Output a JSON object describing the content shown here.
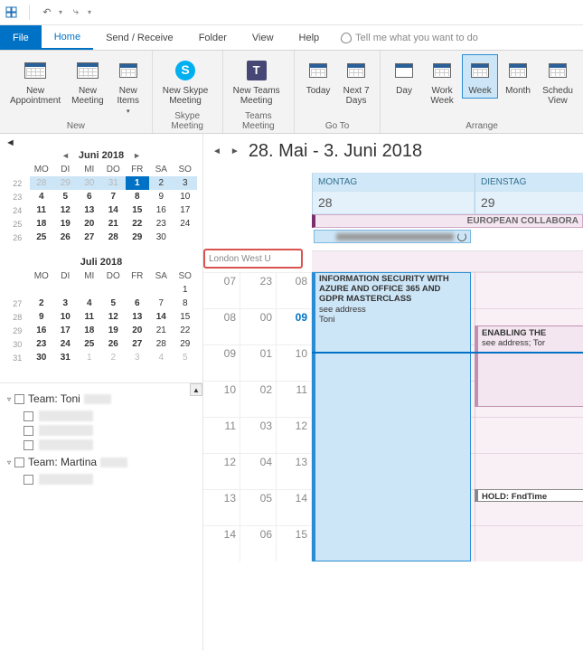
{
  "titlebar": {
    "icons": [
      "window-icon",
      "undo-icon",
      "redo-icon"
    ]
  },
  "menubar": {
    "file": "File",
    "tabs": [
      "Home",
      "Send / Receive",
      "Folder",
      "View",
      "Help"
    ],
    "active": 0,
    "tell_me": "Tell me what you want to do"
  },
  "ribbon": {
    "new": {
      "appointment": "New\nAppointment",
      "meeting": "New\nMeeting",
      "items": "New\nItems",
      "group_label": "New"
    },
    "skype": {
      "label": "New Skype\nMeeting",
      "group_label": "Skype Meeting"
    },
    "teams": {
      "label": "New Teams\nMeeting",
      "group_label": "Teams Meeting"
    },
    "goto": {
      "today": "Today",
      "next7": "Next 7\nDays",
      "group_label": "Go To"
    },
    "arrange": {
      "day": "Day",
      "workweek": "Work\nWeek",
      "week": "Week",
      "month": "Month",
      "schedule": "Schedu\nView",
      "group_label": "Arrange",
      "selected": "week"
    }
  },
  "minical1": {
    "title": "Juni 2018",
    "dow": [
      "MO",
      "DI",
      "MI",
      "DO",
      "FR",
      "SA",
      "SO"
    ],
    "weeks": [
      {
        "wk": "22",
        "days": [
          {
            "d": "28",
            "cls": "sel dim"
          },
          {
            "d": "29",
            "cls": "sel dim"
          },
          {
            "d": "30",
            "cls": "sel dim"
          },
          {
            "d": "31",
            "cls": "sel dim"
          },
          {
            "d": "1",
            "cls": "today"
          },
          {
            "d": "2",
            "cls": "sel"
          },
          {
            "d": "3",
            "cls": "sel"
          }
        ]
      },
      {
        "wk": "23",
        "days": [
          {
            "d": "4",
            "cls": "bold"
          },
          {
            "d": "5",
            "cls": "bold"
          },
          {
            "d": "6",
            "cls": "bold"
          },
          {
            "d": "7",
            "cls": "bold"
          },
          {
            "d": "8",
            "cls": "bold"
          },
          {
            "d": "9",
            "cls": ""
          },
          {
            "d": "10",
            "cls": ""
          }
        ]
      },
      {
        "wk": "24",
        "days": [
          {
            "d": "11",
            "cls": "bold"
          },
          {
            "d": "12",
            "cls": "bold"
          },
          {
            "d": "13",
            "cls": "bold"
          },
          {
            "d": "14",
            "cls": "bold"
          },
          {
            "d": "15",
            "cls": "bold"
          },
          {
            "d": "16",
            "cls": ""
          },
          {
            "d": "17",
            "cls": ""
          }
        ]
      },
      {
        "wk": "25",
        "days": [
          {
            "d": "18",
            "cls": "bold"
          },
          {
            "d": "19",
            "cls": "bold"
          },
          {
            "d": "20",
            "cls": "bold"
          },
          {
            "d": "21",
            "cls": "bold"
          },
          {
            "d": "22",
            "cls": "bold"
          },
          {
            "d": "23",
            "cls": ""
          },
          {
            "d": "24",
            "cls": ""
          }
        ]
      },
      {
        "wk": "26",
        "days": [
          {
            "d": "25",
            "cls": "bold"
          },
          {
            "d": "26",
            "cls": "bold"
          },
          {
            "d": "27",
            "cls": "bold"
          },
          {
            "d": "28",
            "cls": "bold"
          },
          {
            "d": "29",
            "cls": "bold"
          },
          {
            "d": "30",
            "cls": ""
          },
          {
            "d": "",
            "cls": ""
          }
        ]
      }
    ]
  },
  "minical2": {
    "title": "Juli 2018",
    "dow": [
      "MO",
      "DI",
      "MI",
      "DO",
      "FR",
      "SA",
      "SO"
    ],
    "weeks": [
      {
        "wk": "",
        "days": [
          {
            "d": "",
            "cls": ""
          },
          {
            "d": "",
            "cls": ""
          },
          {
            "d": "",
            "cls": ""
          },
          {
            "d": "",
            "cls": ""
          },
          {
            "d": "",
            "cls": ""
          },
          {
            "d": "",
            "cls": ""
          },
          {
            "d": "1",
            "cls": ""
          }
        ]
      },
      {
        "wk": "27",
        "days": [
          {
            "d": "2",
            "cls": "bold"
          },
          {
            "d": "3",
            "cls": "bold"
          },
          {
            "d": "4",
            "cls": "bold"
          },
          {
            "d": "5",
            "cls": "bold"
          },
          {
            "d": "6",
            "cls": "bold"
          },
          {
            "d": "7",
            "cls": ""
          },
          {
            "d": "8",
            "cls": ""
          }
        ]
      },
      {
        "wk": "28",
        "days": [
          {
            "d": "9",
            "cls": "bold"
          },
          {
            "d": "10",
            "cls": "bold"
          },
          {
            "d": "11",
            "cls": "bold"
          },
          {
            "d": "12",
            "cls": "bold"
          },
          {
            "d": "13",
            "cls": "bold"
          },
          {
            "d": "14",
            "cls": "bold"
          },
          {
            "d": "15",
            "cls": ""
          }
        ]
      },
      {
        "wk": "29",
        "days": [
          {
            "d": "16",
            "cls": "bold"
          },
          {
            "d": "17",
            "cls": "bold"
          },
          {
            "d": "18",
            "cls": "bold"
          },
          {
            "d": "19",
            "cls": "bold"
          },
          {
            "d": "20",
            "cls": "bold"
          },
          {
            "d": "21",
            "cls": ""
          },
          {
            "d": "22",
            "cls": ""
          }
        ]
      },
      {
        "wk": "30",
        "days": [
          {
            "d": "23",
            "cls": "bold"
          },
          {
            "d": "24",
            "cls": "bold"
          },
          {
            "d": "25",
            "cls": "bold"
          },
          {
            "d": "26",
            "cls": "bold"
          },
          {
            "d": "27",
            "cls": "bold"
          },
          {
            "d": "28",
            "cls": ""
          },
          {
            "d": "29",
            "cls": ""
          }
        ]
      },
      {
        "wk": "31",
        "days": [
          {
            "d": "30",
            "cls": "bold"
          },
          {
            "d": "31",
            "cls": "bold"
          },
          {
            "d": "1",
            "cls": "dim"
          },
          {
            "d": "2",
            "cls": "dim"
          },
          {
            "d": "3",
            "cls": "dim"
          },
          {
            "d": "4",
            "cls": "dim"
          },
          {
            "d": "5",
            "cls": "dim"
          }
        ]
      }
    ]
  },
  "teams": [
    {
      "name": "Team: Toni",
      "members": 3
    },
    {
      "name": "Team: Martina",
      "members": 1
    }
  ],
  "content": {
    "range_title": "28. Mai - 3. Juni 2018",
    "days": [
      {
        "dow": "MONTAG",
        "num": "28"
      },
      {
        "dow": "DIENSTAG",
        "num": "29"
      }
    ],
    "allday": {
      "euro": "EUROPEAN COLLABORA"
    },
    "location_box": "London West U",
    "time_rulers": {
      "left": [
        "07",
        "08",
        "09",
        "10",
        "11",
        "12",
        "13",
        "14"
      ],
      "mid": [
        "23",
        "00",
        "01",
        "02",
        "03",
        "04",
        "05",
        "06"
      ],
      "right": [
        "08",
        "09",
        "10",
        "11",
        "12",
        "13",
        "14",
        "15"
      ]
    },
    "events": {
      "infosec": {
        "title": "INFORMATION SECURITY WITH AZURE AND OFFICE 365 AND GDPR MASTERCLASS",
        "sub1": "see address",
        "sub2": "Toni"
      },
      "enabling": {
        "title": "ENABLING THE",
        "sub": "see address; Tor"
      },
      "hold": "HOLD: FndTime"
    }
  }
}
